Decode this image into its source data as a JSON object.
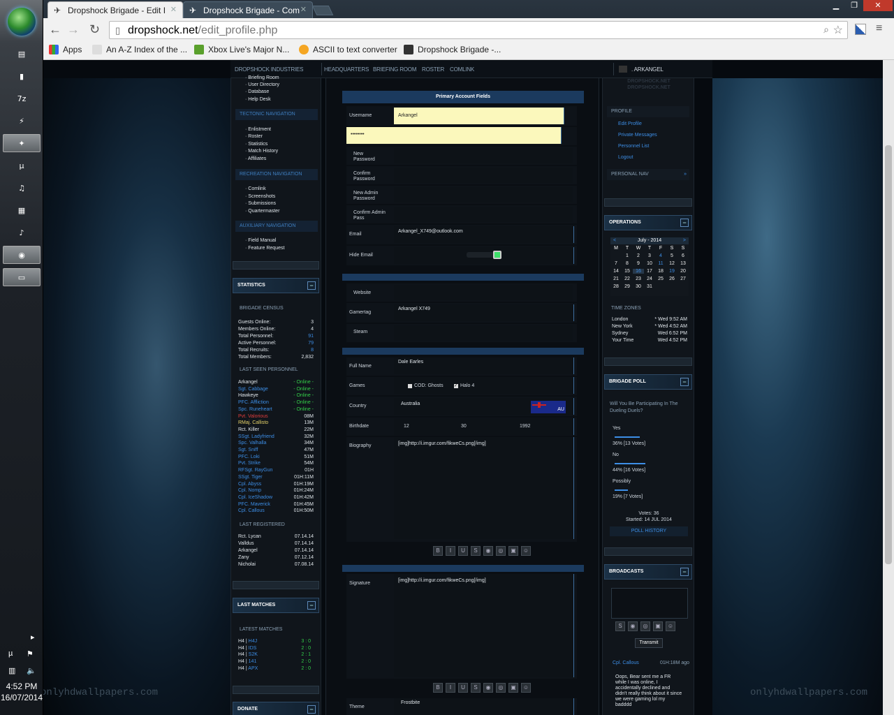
{
  "taskbar": {
    "clock_time": "4:52 PM",
    "clock_date": "16/07/2014"
  },
  "browser": {
    "tabs": [
      {
        "title": "Dropshock Brigade - Edit I"
      },
      {
        "title": "Dropshock Brigade - Com"
      }
    ],
    "url_domain": "dropshock.net",
    "url_path": "/edit_profile.php",
    "bookmarks": [
      "Apps",
      "An A-Z Index of the ...",
      "Xbox Live's Major N...",
      "ASCII to text converter",
      "Dropshock Brigade -..."
    ]
  },
  "topnav": {
    "items": [
      "DROPSHOCK INDUSTRIES",
      "HEADQUARTERS",
      "BRIEFING ROOM",
      "ROSTER",
      "COMLINK"
    ],
    "user": ". ARKANGEL"
  },
  "left_sidebar": {
    "top_links": [
      "Briefing Room",
      "User Directory",
      "Database",
      "Help Desk"
    ],
    "tectonic_head": "TECTONIC NAVIGATION",
    "tectonic_links": [
      "Enlistment",
      "Roster",
      "Statistics",
      "Match History",
      "Affiliates"
    ],
    "recreation_head": "RECREATION NAVIGATION",
    "recreation_links": [
      "Comlink",
      "Screenshots",
      "Submissions",
      "Quartermaster"
    ],
    "auxiliary_head": "AUXILIARY NAVIGATION",
    "auxiliary_links": [
      "Field Manual",
      "Feature Request"
    ],
    "statistics_title": "STATISTICS",
    "census_head": "BRIGADE CENSUS",
    "census": [
      {
        "label": "Guests Online:",
        "value": "3",
        "blue": false
      },
      {
        "label": "Members Online:",
        "value": "4",
        "blue": false
      },
      {
        "label": "Total Personnel:",
        "value": "91",
        "blue": true
      },
      {
        "label": "Active Personnel:",
        "value": "79",
        "blue": true
      },
      {
        "label": "Total Recruits:",
        "value": "8",
        "blue": true
      },
      {
        "label": "Total Members:",
        "value": "2,832",
        "blue": false
      }
    ],
    "last_seen_head": "LAST SEEN PERSONNEL",
    "last_seen": [
      {
        "name": "Arkangel",
        "time": "- Online -",
        "c": "w",
        "g": true
      },
      {
        "name": "Sgt. Cabbage",
        "time": "- Online -",
        "c": "b",
        "g": true
      },
      {
        "name": "Hawkeye",
        "time": "- Online -",
        "c": "w",
        "g": true
      },
      {
        "name": "PFC. Affliction",
        "time": "- Online -",
        "c": "b",
        "g": true
      },
      {
        "name": "Spc. Runeheart",
        "time": "- Online -",
        "c": "b",
        "g": true
      },
      {
        "name": "Pvt. Valorious",
        "time": "08M",
        "c": "r",
        "g": false
      },
      {
        "name": "RMaj. Callisto",
        "time": "13M",
        "c": "y",
        "g": false
      },
      {
        "name": "Rct. Killer",
        "time": "22M",
        "c": "w",
        "g": false
      },
      {
        "name": "SSgt. Ladyfriend",
        "time": "32M",
        "c": "b",
        "g": false
      },
      {
        "name": "Spc. Valhalla",
        "time": "34M",
        "c": "b",
        "g": false
      },
      {
        "name": "Sgt. Sniff",
        "time": "47M",
        "c": "b",
        "g": false
      },
      {
        "name": "PFC. Loki",
        "time": "51M",
        "c": "b",
        "g": false
      },
      {
        "name": "Pvt. Strike",
        "time": "54M",
        "c": "b",
        "g": false
      },
      {
        "name": "RFSgt. RayGun",
        "time": "01H",
        "c": "b",
        "g": false
      },
      {
        "name": "SSgt. Tiger",
        "time": "01H:11M",
        "c": "b",
        "g": false
      },
      {
        "name": "Cpl. Abyss",
        "time": "01H:19M",
        "c": "b",
        "g": false
      },
      {
        "name": "Cpl. Nomp",
        "time": "01H:24M",
        "c": "b",
        "g": false
      },
      {
        "name": "Cpl. IceShadow",
        "time": "01H:42M",
        "c": "b",
        "g": false
      },
      {
        "name": "PFC. Maverick",
        "time": "01H:45M",
        "c": "b",
        "g": false
      },
      {
        "name": "Cpl. Callous",
        "time": "01H:50M",
        "c": "b",
        "g": false
      }
    ],
    "last_registered_head": "LAST REGISTERED",
    "last_registered": [
      {
        "name": "Rct. Lycan",
        "date": "07.14.14"
      },
      {
        "name": "Valldus",
        "date": "07.14.14"
      },
      {
        "name": "Arkangel",
        "date": "07.14.14"
      },
      {
        "name": "Zany",
        "date": "07.12.14"
      },
      {
        "name": "Nicholai",
        "date": "07.08.14"
      }
    ],
    "last_matches_title": "LAST MATCHES",
    "latest_matches_head": "LATEST MATCHES",
    "matches": [
      {
        "game": "H4 |",
        "opp": "H4J",
        "score": "3 : 0"
      },
      {
        "game": "H4 |",
        "opp": "IDS",
        "score": "2 : 0"
      },
      {
        "game": "H4 |",
        "opp": "S2K",
        "score": "2 : 1"
      },
      {
        "game": "H4 |",
        "opp": "141",
        "score": "2 : 0"
      },
      {
        "game": "H4 |",
        "opp": "APX",
        "score": "2 : 0"
      }
    ],
    "donate_title": "DONATE"
  },
  "form": {
    "header": "Primary Account Fields",
    "username_label": "Username",
    "username_value": "Arkangel",
    "password_dots": "••••••••",
    "new_password_label": "New Password",
    "confirm_password_label": "Confirm Password",
    "new_admin_label": "New Admin Password",
    "confirm_admin_label": "Confirm Admin Pass",
    "email_label": "Email",
    "email_value": "Arkangel_X749@outlook.com",
    "hide_email_label": "Hide Email",
    "website_label": "Website",
    "gamertag_label": "Gamertag",
    "gamertag_value": "Arkangel X749",
    "steam_label": "Steam",
    "fullname_label": "Full Name",
    "fullname_value": "Dale Earles",
    "games_label": "Games",
    "game1": "COD: Ghosts",
    "game2": "Halo 4",
    "country_label": "Country",
    "country_value": "Australia",
    "flag_text": "AU",
    "birthdate_label": "Birthdate",
    "birth_day": "12",
    "birth_month": "30",
    "birth_year": "1992",
    "biography_label": "Biography",
    "biography_value": "[img]http://i.imgur.com/fikweCs.png[/img]",
    "signature_label": "Signature",
    "signature_value": "[img]http://i.imgur.com/fikweCs.png[/img]",
    "theme_label": "Theme",
    "theme_value": "Frostbite",
    "editor_buttons": [
      "B",
      "I",
      "U",
      "S",
      "◉",
      "◎",
      "▣",
      "☺"
    ]
  },
  "right_sidebar": {
    "logo_text": "DROPSHOCK.NET",
    "profile_head": "PROFILE",
    "profile_links": [
      "Edit Profile",
      "Private Messages",
      "Personnel List",
      "Logout"
    ],
    "personal_nav": "PERSONAL NAV",
    "operations_title": "OPERATIONS",
    "calendar": {
      "month": "July - 2014",
      "days": [
        "M",
        "T",
        "W",
        "T",
        "F",
        "S",
        "S"
      ],
      "rows": [
        [
          "",
          "1",
          "2",
          "3",
          "4",
          "5",
          "6"
        ],
        [
          "7",
          "8",
          "9",
          "10",
          "11",
          "12",
          "13"
        ],
        [
          "14",
          "15",
          "16",
          "17",
          "18",
          "19",
          "20"
        ],
        [
          "21",
          "22",
          "23",
          "24",
          "25",
          "26",
          "27"
        ],
        [
          "28",
          "29",
          "30",
          "31",
          "",
          "",
          ""
        ]
      ]
    },
    "timezones_head": "TIME ZONES",
    "timezones": [
      {
        "city": "London",
        "time": "* Wed 9:52 AM"
      },
      {
        "city": "New York",
        "time": "* Wed 4:52 AM"
      },
      {
        "city": "Sydney",
        "time": "Wed 6:52 PM"
      },
      {
        "city": "Your Time",
        "time": "Wed 4:52 PM"
      }
    ],
    "poll_title": "BRIGADE POLL",
    "poll_question": "Will You Be Participating In The Dueling Duels?",
    "poll_options": [
      {
        "label": "Yes",
        "result": "36% [13 Votes]",
        "pct": 36
      },
      {
        "label": "No",
        "result": "44% [16 Votes]",
        "pct": 44
      },
      {
        "label": "Possibly",
        "result": "19% [7 Votes]",
        "pct": 19
      }
    ],
    "poll_votes": "Votes: 36",
    "poll_started": "Started: 14 JUL 2014",
    "poll_history": "POLL HISTORY",
    "broadcasts_title": "BROADCASTS",
    "transmit_label": "Transmit",
    "bc_user": "Cpl. Callous",
    "bc_time": "01H:18M ago",
    "bc_text": "Oops, Bear sent me a FR while I was online, I accidentally declined and didn't really think about it since we were gaming lol my badddd"
  },
  "watermark": "onlyhdwallpapers.com"
}
